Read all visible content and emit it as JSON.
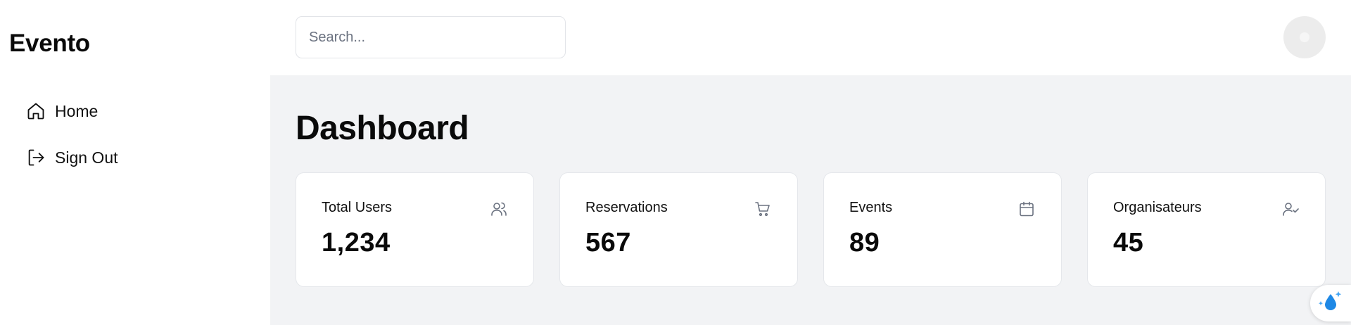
{
  "sidebar": {
    "brand": "Evento",
    "items": [
      {
        "label": "Home",
        "icon": "home-icon"
      },
      {
        "label": "Sign Out",
        "icon": "sign-out-icon"
      }
    ]
  },
  "header": {
    "search_placeholder": "Search...",
    "avatar_icon": "avatar"
  },
  "main": {
    "title": "Dashboard",
    "cards": [
      {
        "label": "Total Users",
        "value": "1,234",
        "icon": "users-icon"
      },
      {
        "label": "Reservations",
        "value": "567",
        "icon": "cart-icon"
      },
      {
        "label": "Events",
        "value": "89",
        "icon": "calendar-icon"
      },
      {
        "label": "Organisateurs",
        "value": "45",
        "icon": "user-check-icon"
      }
    ]
  },
  "colors": {
    "background_main": "#f2f3f5",
    "card_background": "#ffffff",
    "border": "#e5e7eb",
    "icon_muted": "#6b7280",
    "floating_accent": "#1e88e5"
  }
}
